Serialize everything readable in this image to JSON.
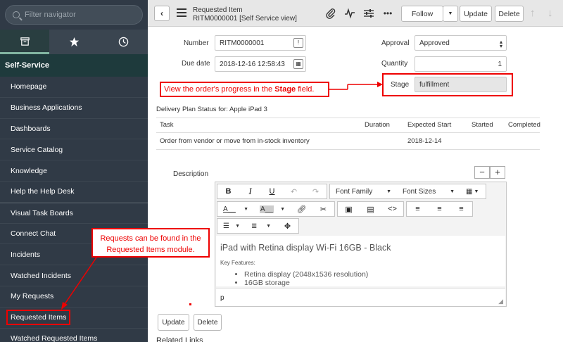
{
  "sidebar": {
    "filter_placeholder": "Filter navigator",
    "app_header": "Self-Service",
    "items": [
      {
        "label": "Homepage"
      },
      {
        "label": "Business Applications"
      },
      {
        "label": "Dashboards"
      },
      {
        "label": "Service Catalog"
      },
      {
        "label": "Knowledge"
      },
      {
        "label": "Help the Help Desk"
      },
      {
        "label": "Visual Task Boards"
      },
      {
        "label": "Connect Chat"
      },
      {
        "label": "Incidents"
      },
      {
        "label": "Watched Incidents"
      },
      {
        "label": "My Requests"
      },
      {
        "label": "Requested Items"
      },
      {
        "label": "Watched Requested Items"
      }
    ]
  },
  "header": {
    "title": "Requested Item",
    "subtitle": "RITM0000001 [Self Service view]",
    "follow": "Follow",
    "update": "Update",
    "delete": "Delete"
  },
  "form": {
    "number_label": "Number",
    "number_value": "RITM0000001",
    "due_label": "Due date",
    "due_value": "2018-12-16 12:58:43",
    "approval_label": "Approval",
    "approval_value": "Approved",
    "quantity_label": "Quantity",
    "quantity_value": "1",
    "stage_label": "Stage",
    "stage_value": "fulfillment"
  },
  "callouts": {
    "stage_prefix": "View the order's progress in the ",
    "stage_bold": "Stage",
    "stage_suffix": " field.",
    "requests_line1": "Requests can be found in the",
    "requests_line2": "Requested Items module."
  },
  "plan": {
    "title": "Delivery Plan Status for: Apple iPad 3",
    "headers": [
      "Task",
      "Duration",
      "Expected Start",
      "Started",
      "Completed"
    ],
    "rows": [
      {
        "task": "Order from vendor or move from in-stock inventory",
        "duration": "",
        "expected_start": "2018-12-14",
        "started": "",
        "completed": ""
      }
    ]
  },
  "description": {
    "label": "Description",
    "font_family": "Font Family",
    "font_sizes": "Font Sizes",
    "heading": "iPad with Retina display Wi-Fi 16GB - Black",
    "key_features": "Key Features:",
    "features": [
      "Retina display (2048x1536 resolution)",
      "16GB storage"
    ],
    "status_path": "p"
  },
  "buttons": {
    "update": "Update",
    "delete": "Delete"
  },
  "related_links": "Related Links"
}
